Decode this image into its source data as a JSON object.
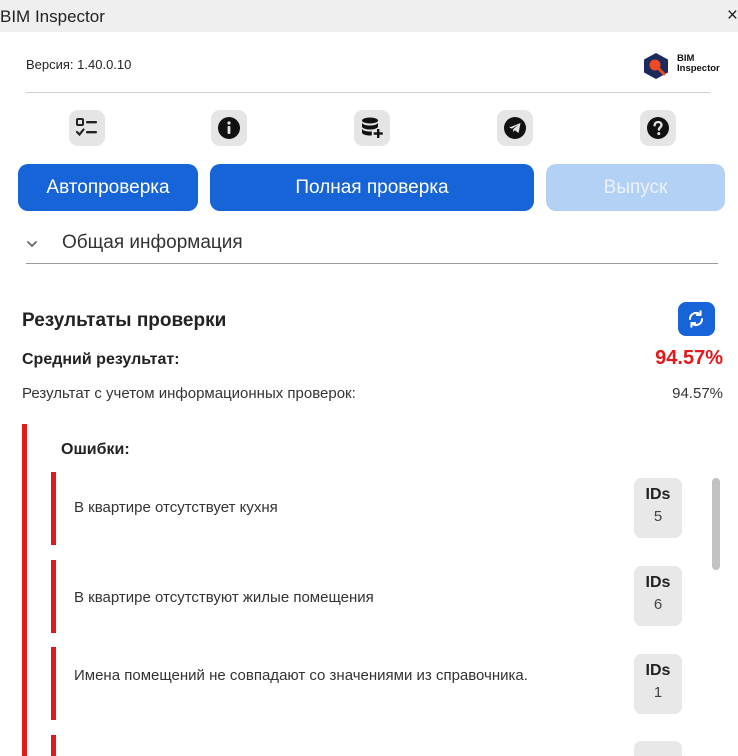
{
  "window": {
    "title": "BIM Inspector",
    "close": "×"
  },
  "header": {
    "version_text": "Версия: 1.40.0.10",
    "logo_line1": "BIM",
    "logo_line2": "Inspector"
  },
  "toolbar": {
    "icons": [
      {
        "name": "checklist-icon"
      },
      {
        "name": "info-icon"
      },
      {
        "name": "database-add-icon"
      },
      {
        "name": "telegram-icon"
      },
      {
        "name": "help-icon"
      }
    ]
  },
  "buttons": {
    "auto_check": "Автопроверка",
    "full_check": "Полная проверка",
    "release": "Выпуск"
  },
  "section": {
    "general_info": "Общая информация"
  },
  "results": {
    "title": "Результаты проверки",
    "avg_label": "Средний результат:",
    "avg_value": "94.57%",
    "info_label": "Результат с учетом информационных проверок:",
    "info_value": "94.57%",
    "errors_title": "Ошибки:",
    "errors": [
      {
        "text": "В квартире отсутствует кухня",
        "ids_label": "IDs",
        "ids_count": "5"
      },
      {
        "text": "В квартире отсутствуют жилые помещения",
        "ids_label": "IDs",
        "ids_count": "6"
      },
      {
        "text": "Имена помещений не совпадают со значениями из справочника.",
        "ids_label": "IDs",
        "ids_count": "1"
      }
    ]
  },
  "colors": {
    "accent": "#1764d8",
    "accent_disabled": "#b3d0f5",
    "error": "#e01b1b",
    "score": "#e4171b"
  }
}
